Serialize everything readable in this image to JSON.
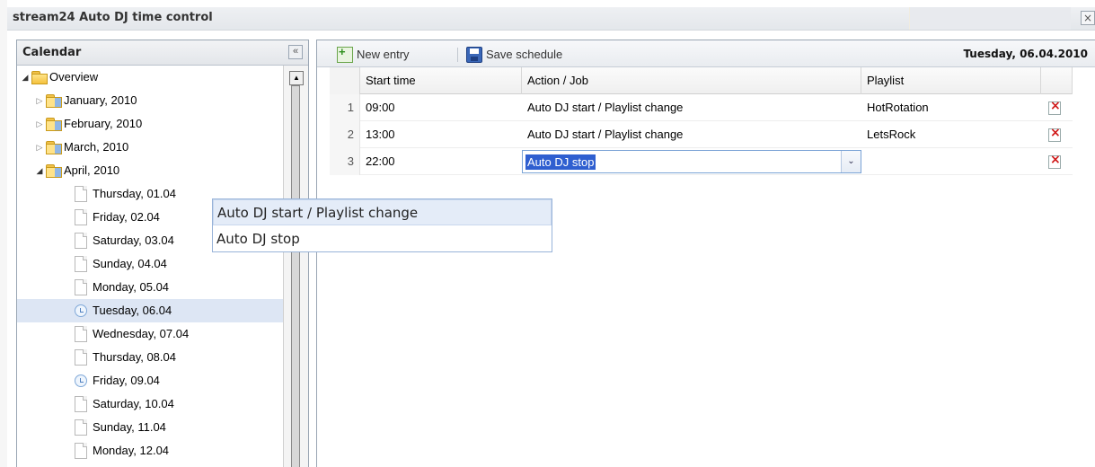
{
  "window": {
    "title": "stream24 Auto DJ time control",
    "close_label": "×"
  },
  "calendar": {
    "title": "Calendar",
    "collapse_label": "«",
    "tree": [
      {
        "label": "Overview",
        "level": 0,
        "arrow": "◢",
        "icon": "folder"
      },
      {
        "label": "January, 2010",
        "level": 1,
        "arrow": "▷",
        "icon": "folder-month"
      },
      {
        "label": "February, 2010",
        "level": 1,
        "arrow": "▷",
        "icon": "folder-month"
      },
      {
        "label": "March, 2010",
        "level": 1,
        "arrow": "▷",
        "icon": "folder-month"
      },
      {
        "label": "April, 2010",
        "level": 1,
        "arrow": "◢",
        "icon": "folder-month"
      },
      {
        "label": "Thursday, 01.04",
        "level": 2,
        "icon": "page"
      },
      {
        "label": "Friday, 02.04",
        "level": 2,
        "icon": "page"
      },
      {
        "label": "Saturday, 03.04",
        "level": 2,
        "icon": "page"
      },
      {
        "label": "Sunday, 04.04",
        "level": 2,
        "icon": "page"
      },
      {
        "label": "Monday, 05.04",
        "level": 2,
        "icon": "page"
      },
      {
        "label": "Tuesday, 06.04",
        "level": 2,
        "icon": "clock",
        "selected": true
      },
      {
        "label": "Wednesday, 07.04",
        "level": 2,
        "icon": "page"
      },
      {
        "label": "Thursday, 08.04",
        "level": 2,
        "icon": "page"
      },
      {
        "label": "Friday, 09.04",
        "level": 2,
        "icon": "clock"
      },
      {
        "label": "Saturday, 10.04",
        "level": 2,
        "icon": "page"
      },
      {
        "label": "Sunday, 11.04",
        "level": 2,
        "icon": "page"
      },
      {
        "label": "Monday, 12.04",
        "level": 2,
        "icon": "page"
      }
    ],
    "scroll_up_label": "▲"
  },
  "toolbar": {
    "new_entry_label": "New entry",
    "save_schedule_label": "Save schedule",
    "current_date": "Tuesday, 06.04.2010"
  },
  "grid": {
    "headers": {
      "start_time": "Start time",
      "action": "Action / Job",
      "playlist": "Playlist"
    },
    "rows": [
      {
        "num": "1",
        "start_time": "09:00",
        "action": "Auto DJ start / Playlist change",
        "playlist": "HotRotation"
      },
      {
        "num": "2",
        "start_time": "13:00",
        "action": "Auto DJ start / Playlist change",
        "playlist": "LetsRock"
      },
      {
        "num": "3",
        "start_time": "22:00",
        "action": "Auto DJ stop",
        "playlist": ""
      }
    ]
  },
  "editor": {
    "value": "Auto DJ stop",
    "trigger_label": "⌄",
    "options": [
      "Auto DJ start / Playlist change",
      "Auto DJ stop"
    ]
  },
  "colors": {
    "selection_bg": "#dde6f4",
    "text_highlight": "#2f5fd0",
    "delete_red": "#d01818"
  }
}
